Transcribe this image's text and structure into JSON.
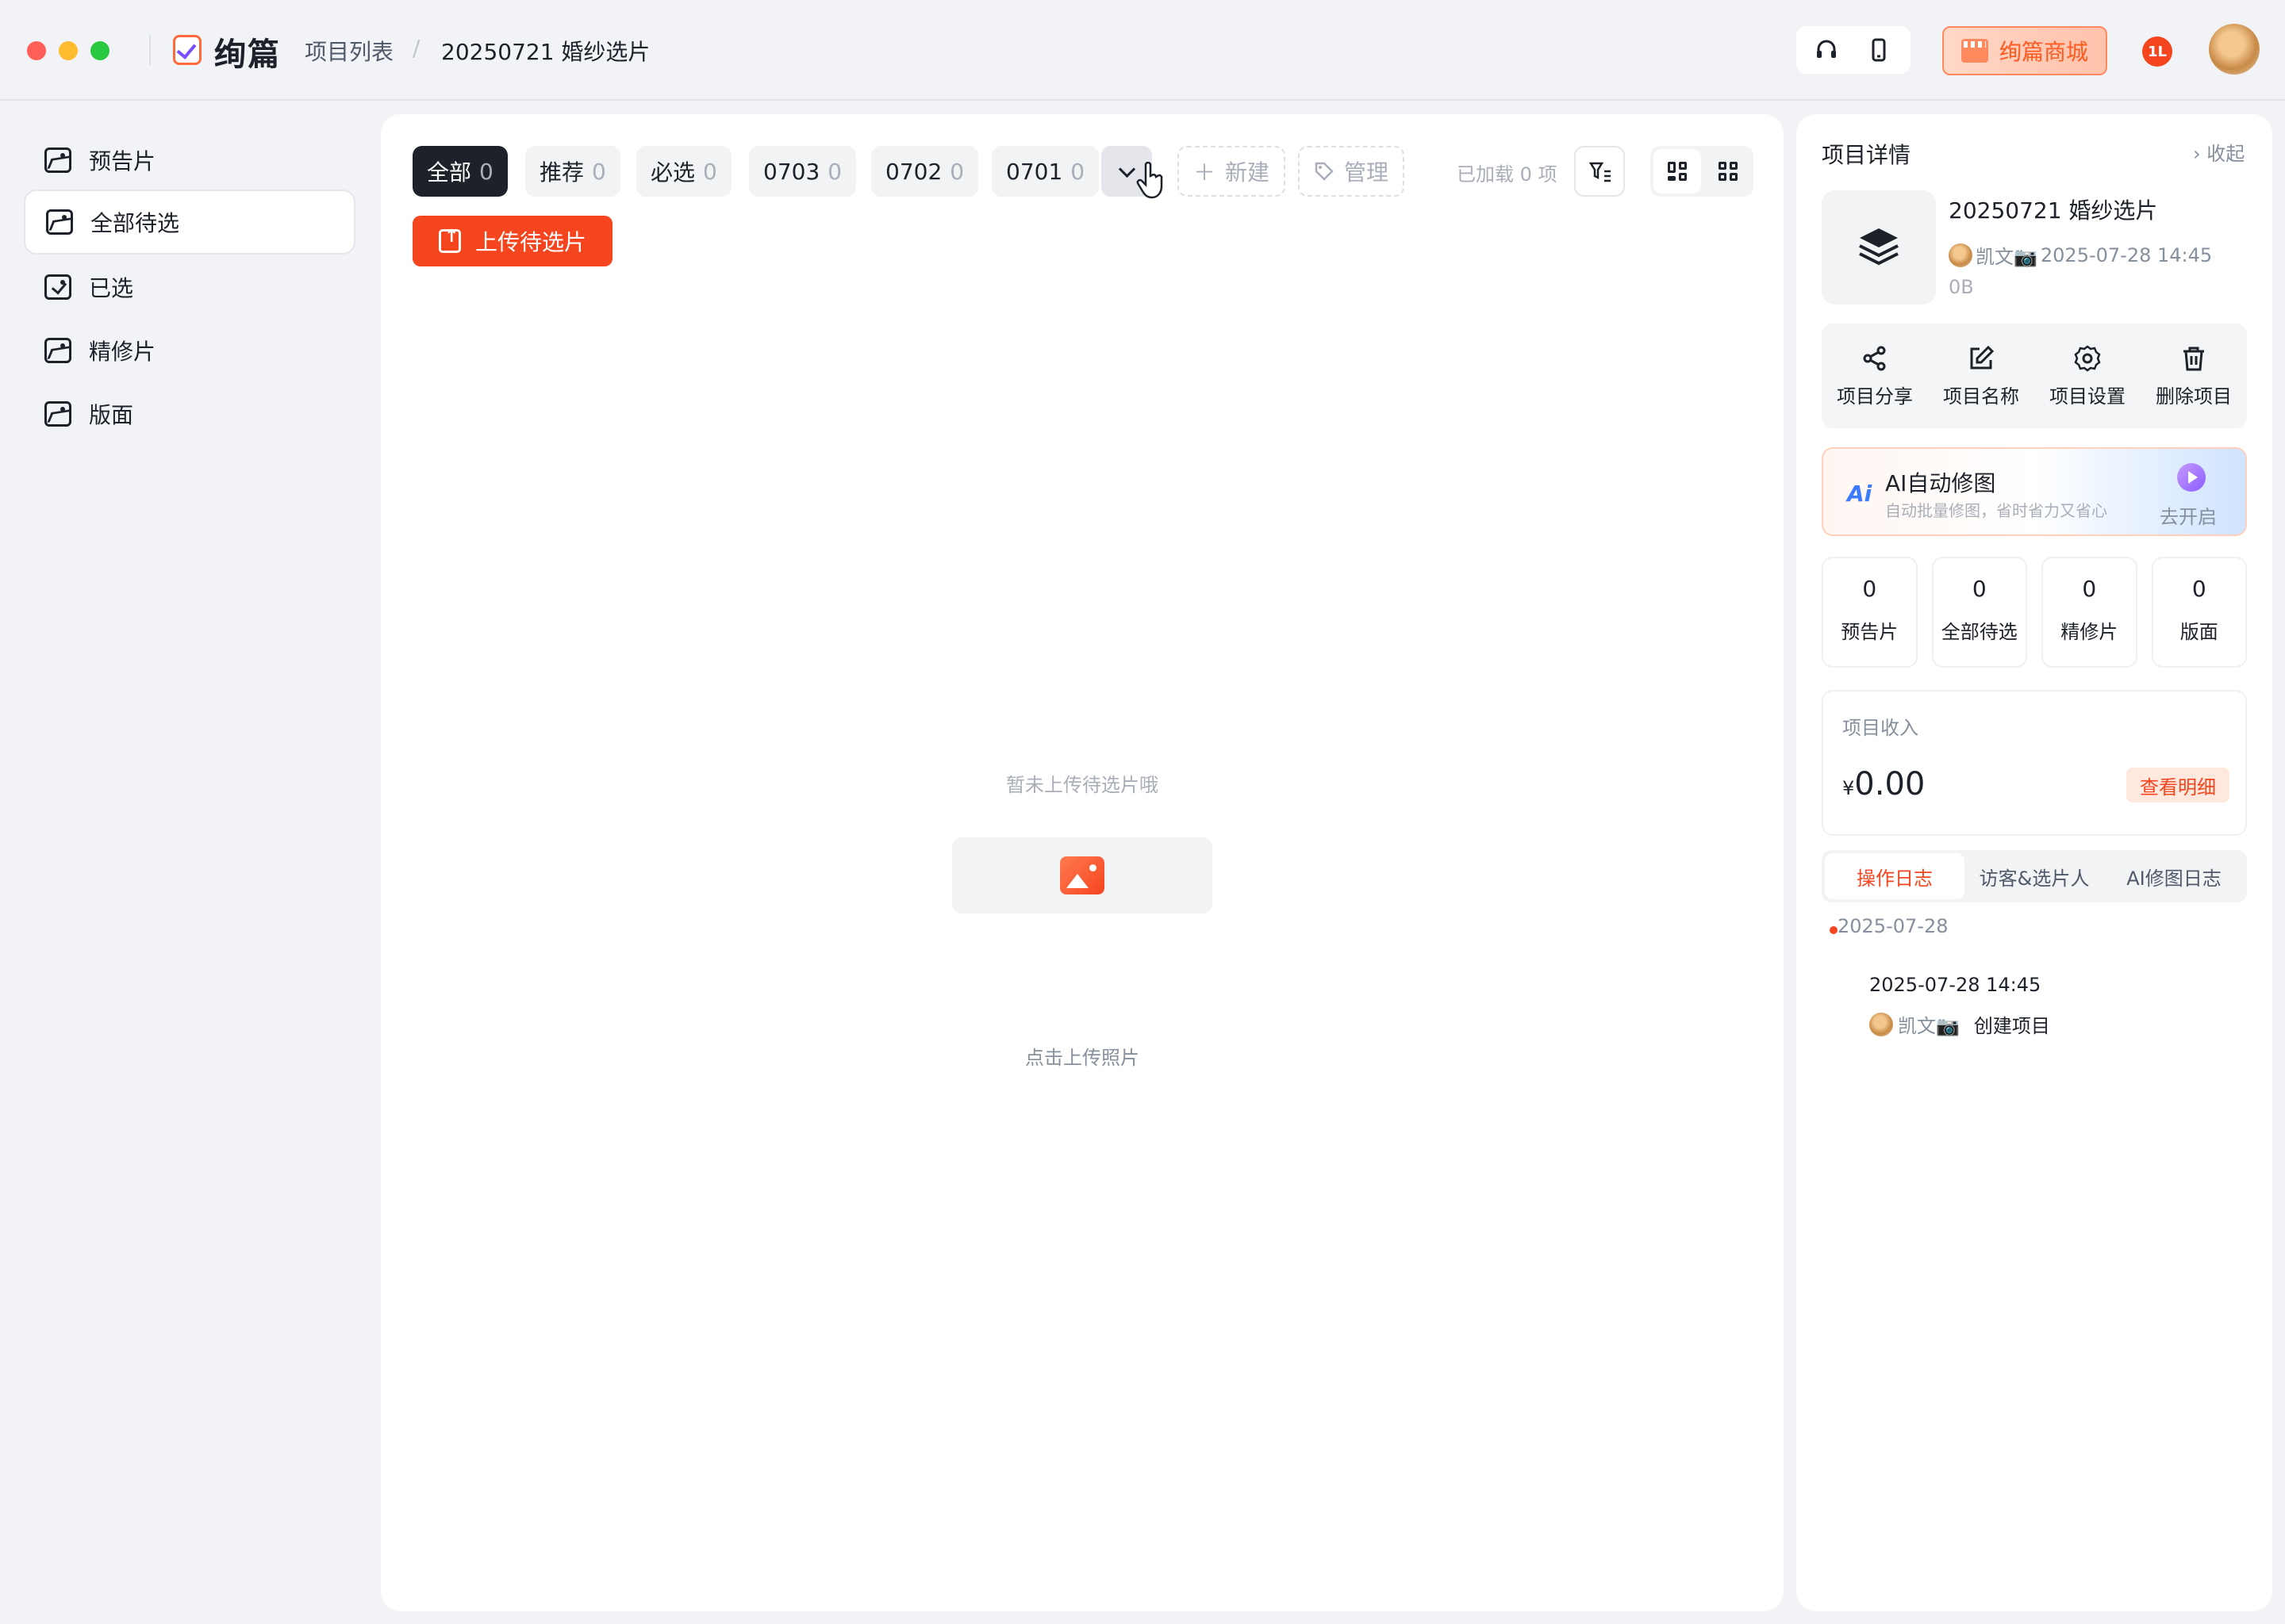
{
  "topbar": {
    "app_name": "绚篇",
    "breadcrumb": [
      "项目列表",
      "20250721 婚纱选片"
    ],
    "shop_label": "绚篇商城",
    "notification_badge": "1L",
    "icons": [
      "headset-icon",
      "phone-icon",
      "shop-icon"
    ]
  },
  "sidebar": {
    "items": [
      {
        "label": "预告片",
        "icon": "image-icon",
        "active": false
      },
      {
        "label": "全部待选",
        "icon": "image-icon",
        "active": true
      },
      {
        "label": "已选",
        "icon": "image-check-icon",
        "active": false
      },
      {
        "label": "精修片",
        "icon": "image-icon",
        "active": false
      },
      {
        "label": "版面",
        "icon": "image-icon",
        "active": false
      }
    ]
  },
  "main": {
    "tags": [
      {
        "label": "全部",
        "count": "0",
        "active": true
      },
      {
        "label": "推荐",
        "count": "0"
      },
      {
        "label": "必选",
        "count": "0"
      },
      {
        "label": "0703",
        "count": "0"
      },
      {
        "label": "0702",
        "count": "0"
      },
      {
        "label": "0701",
        "count": "0"
      }
    ],
    "new_label": "新建",
    "manage_label": "管理",
    "loaded_text": "已加载 0 项",
    "upload_label": "上传待选片",
    "empty_text": "暂未上传待选片哦",
    "empty_hint": "点击上传照片"
  },
  "detail": {
    "title": "项目详情",
    "collapse_label": "收起",
    "project_name": "20250721 婚纱选片",
    "owner": "凯文📷",
    "created": "2025-07-28 14:45",
    "size": "0B",
    "actions": [
      {
        "label": "项目分享",
        "icon": "share-icon"
      },
      {
        "label": "项目名称",
        "icon": "edit-icon"
      },
      {
        "label": "项目设置",
        "icon": "settings-icon"
      },
      {
        "label": "删除项目",
        "icon": "trash-icon"
      }
    ],
    "ai": {
      "logo": "Ai",
      "title": "AI自动修图",
      "subtitle": "自动批量修图，省时省力又省心",
      "cta": "去开启"
    },
    "stats": [
      {
        "value": "0",
        "label": "预告片"
      },
      {
        "value": "0",
        "label": "全部待选"
      },
      {
        "value": "0",
        "label": "精修片"
      },
      {
        "value": "0",
        "label": "版面"
      }
    ],
    "income": {
      "label": "项目收入",
      "currency": "¥",
      "amount": "0.00",
      "detail_label": "查看明细"
    },
    "log_tabs": [
      "操作日志",
      "访客&选片人",
      "AI修图日志"
    ],
    "log": {
      "date": "2025-07-28",
      "time": "2025-07-28 14:45",
      "user": "凯文📷",
      "action": "创建项目"
    }
  },
  "colors": {
    "accent": "#f5451f",
    "dark": "#1d2129",
    "muted": "#86909c",
    "panel": "#ffffff",
    "background": "#f2f3f6"
  }
}
